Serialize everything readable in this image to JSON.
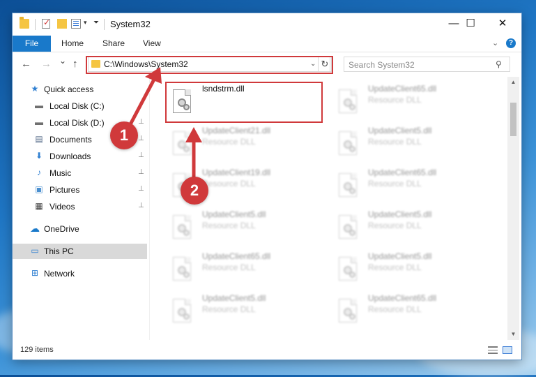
{
  "window": {
    "title": "System32",
    "minimize_glyph": "—",
    "maximize_glyph": "☐",
    "close_glyph": "✕"
  },
  "ribbon": {
    "tabs": [
      "File",
      "Home",
      "Share",
      "View"
    ],
    "expand_glyph": "⌄",
    "help_glyph": "?"
  },
  "address_bar": {
    "path": "C:\\Windows\\System32",
    "back_glyph": "←",
    "forward_glyph": "→",
    "recent_glyph": "⌄",
    "up_glyph": "↑",
    "dropdown_glyph": "⌄",
    "refresh_glyph": "↻"
  },
  "search": {
    "placeholder": "Search System32",
    "icon_glyph": "⚲"
  },
  "nav_pane": {
    "items": [
      {
        "label": "Quick access",
        "icon": "star-icon",
        "glyph": "★",
        "pinned": false
      },
      {
        "label": "Local Disk (C:)",
        "icon": "drive-icon",
        "glyph": "▬",
        "pinned": false
      },
      {
        "label": "Local Disk (D:)",
        "icon": "drive-icon",
        "glyph": "▬",
        "pinned": true
      },
      {
        "label": "Documents",
        "icon": "documents-icon",
        "glyph": "▤",
        "pinned": true
      },
      {
        "label": "Downloads",
        "icon": "download-icon",
        "glyph": "⬇",
        "pinned": true
      },
      {
        "label": "Music",
        "icon": "music-icon",
        "glyph": "♪",
        "pinned": true
      },
      {
        "label": "Pictures",
        "icon": "pictures-icon",
        "glyph": "▣",
        "pinned": true
      },
      {
        "label": "Videos",
        "icon": "video-icon",
        "glyph": "▦",
        "pinned": true
      },
      {
        "label": "OneDrive",
        "icon": "cloud-icon",
        "glyph": "☁",
        "pinned": false
      },
      {
        "label": "This PC",
        "icon": "computer-icon",
        "glyph": "▭",
        "pinned": false
      },
      {
        "label": "Network",
        "icon": "network-icon",
        "glyph": "⊞",
        "pinned": false
      }
    ],
    "pin_glyph": "📌"
  },
  "files": {
    "highlighted": {
      "name": "lsndstrm.dll",
      "type": ""
    },
    "left_column": [
      {
        "name": "UpdateClient21.dll",
        "type": "Resource DLL"
      },
      {
        "name": "UpdateClient19.dll",
        "type": "Resource DLL"
      },
      {
        "name": "UpdateClient5.dll",
        "type": "Resource DLL"
      },
      {
        "name": "UpdateClient65.dll",
        "type": "Resource DLL"
      },
      {
        "name": "UpdateClient5.dll",
        "type": "Resource DLL"
      }
    ],
    "right_column": [
      {
        "name": "UpdateClient65.dll",
        "type": "Resource DLL"
      },
      {
        "name": "UpdateClient5.dll",
        "type": "Resource DLL"
      },
      {
        "name": "UpdateClient65.dll",
        "type": "Resource DLL"
      },
      {
        "name": "UpdateClient5.dll",
        "type": "Resource DLL"
      },
      {
        "name": "UpdateClient5.dll",
        "type": "Resource DLL"
      },
      {
        "name": "UpdateClient65.dll",
        "type": "Resource DLL"
      }
    ]
  },
  "status_bar": {
    "item_count": "129 items"
  },
  "annotations": {
    "callout_1": "1",
    "callout_2": "2",
    "highlight_color": "#d0393b"
  },
  "colors": {
    "accent": "#1979ca",
    "selection": "#d9d9d9"
  }
}
